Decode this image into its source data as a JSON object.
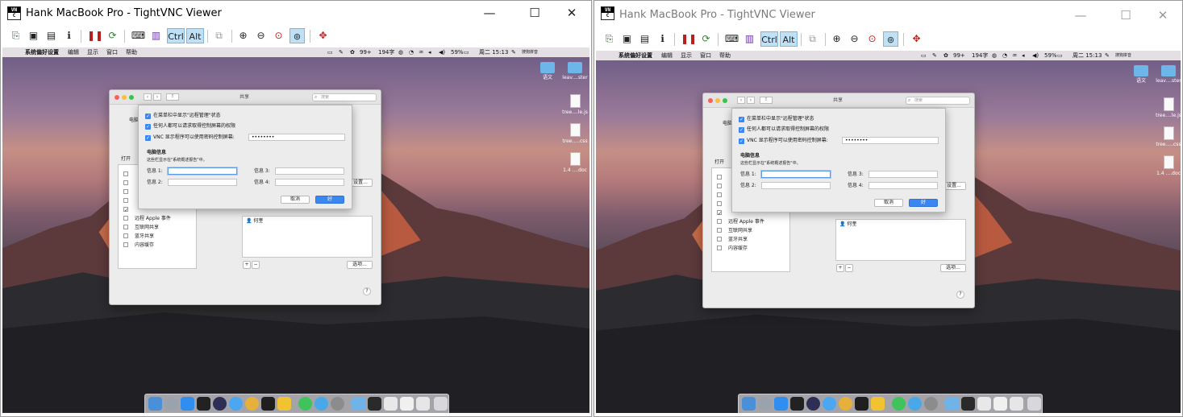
{
  "windows": [
    {
      "title": "Hank MacBook Pro - TightVNC Viewer",
      "controls": {
        "minimize": "—",
        "maximize": "☐",
        "close": "✕"
      },
      "toolbar": {
        "ctrl_label": "Ctrl",
        "alt_label": "Alt"
      },
      "mac": {
        "menubar": {
          "app_menu": "系统偏好设置",
          "items": [
            "编辑",
            "显示",
            "窗口",
            "帮助"
          ],
          "status": {
            "count": "99+",
            "chars": "194字",
            "battery": "59%",
            "clock": "周二 15:13",
            "ime": "搜狗拼音"
          }
        },
        "desktop_icons": [
          "语文",
          "leav....ster",
          "tree....le.js",
          "tree.....css",
          "1.4 ....doc"
        ],
        "sharing": {
          "title": "共享",
          "search_placeholder": "搜索",
          "computer_label": "电脑",
          "list_header": "打开",
          "services": [
            "远程 Apple 事件",
            "互联网共享",
            "蓝牙共享",
            "内容缓存"
          ],
          "user": "何奎",
          "add_btn": "+",
          "remove_btn": "−",
          "settings_btn": "设置...",
          "options_btn": "选项...",
          "help_btn": "?"
        },
        "sheet": {
          "check1": "在菜单栏中显示\"远程管理\"状态",
          "check2": "任何人都可以请求取得控制屏幕的权限",
          "check3": "VNC 显示程序可以使用密码控制屏幕:",
          "password": "••••••••",
          "section_title": "电脑信息",
          "section_desc": "这些栏显示在\"系统概述报告\"中。",
          "info1": "信息 1:",
          "info2": "信息 2:",
          "info3": "信息 3:",
          "info4": "信息 4:",
          "cancel_btn": "取消",
          "ok_btn": "好"
        }
      }
    },
    {
      "title": "Hank MacBook Pro - TightVNC Viewer",
      "controls": {
        "minimize": "—",
        "maximize": "☐",
        "close": "✕"
      },
      "toolbar": {
        "ctrl_label": "Ctrl",
        "alt_label": "Alt"
      },
      "mac": {
        "menubar": {
          "app_menu": "系统偏好设置",
          "items": [
            "编辑",
            "显示",
            "窗口",
            "帮助"
          ],
          "status": {
            "count": "99+",
            "chars": "194字",
            "battery": "59%",
            "clock": "周二 15:13",
            "ime": "搜狗拼音"
          }
        },
        "desktop_icons": [
          "语文",
          "leav....ster",
          "tree....le.js",
          "tree.....css",
          "1.4 ....doc"
        ],
        "sharing": {
          "title": "共享",
          "search_placeholder": "搜索",
          "computer_label": "电脑",
          "list_header": "打开",
          "services": [
            "远程 Apple 事件",
            "互联网共享",
            "蓝牙共享",
            "内容缓存"
          ],
          "user": "何奎",
          "add_btn": "+",
          "remove_btn": "−",
          "settings_btn": "设置...",
          "options_btn": "选项...",
          "help_btn": "?"
        },
        "sheet": {
          "check1": "在菜单栏中显示\"远程管理\"状态",
          "check2": "任何人都可以请求取得控制屏幕的权限",
          "check3": "VNC 显示程序可以使用密码控制屏幕:",
          "password": "••••••••",
          "section_title": "电脑信息",
          "section_desc": "这些栏显示在\"系统概述报告\"中。",
          "info1": "信息 1:",
          "info2": "信息 2:",
          "info3": "信息 3:",
          "info4": "信息 4:",
          "cancel_btn": "取消",
          "ok_btn": "好"
        }
      }
    }
  ],
  "colors": {
    "accent": "#3a87f2",
    "dialog_bg": "#ececec",
    "toolbar_active": "#bfe0f5"
  }
}
